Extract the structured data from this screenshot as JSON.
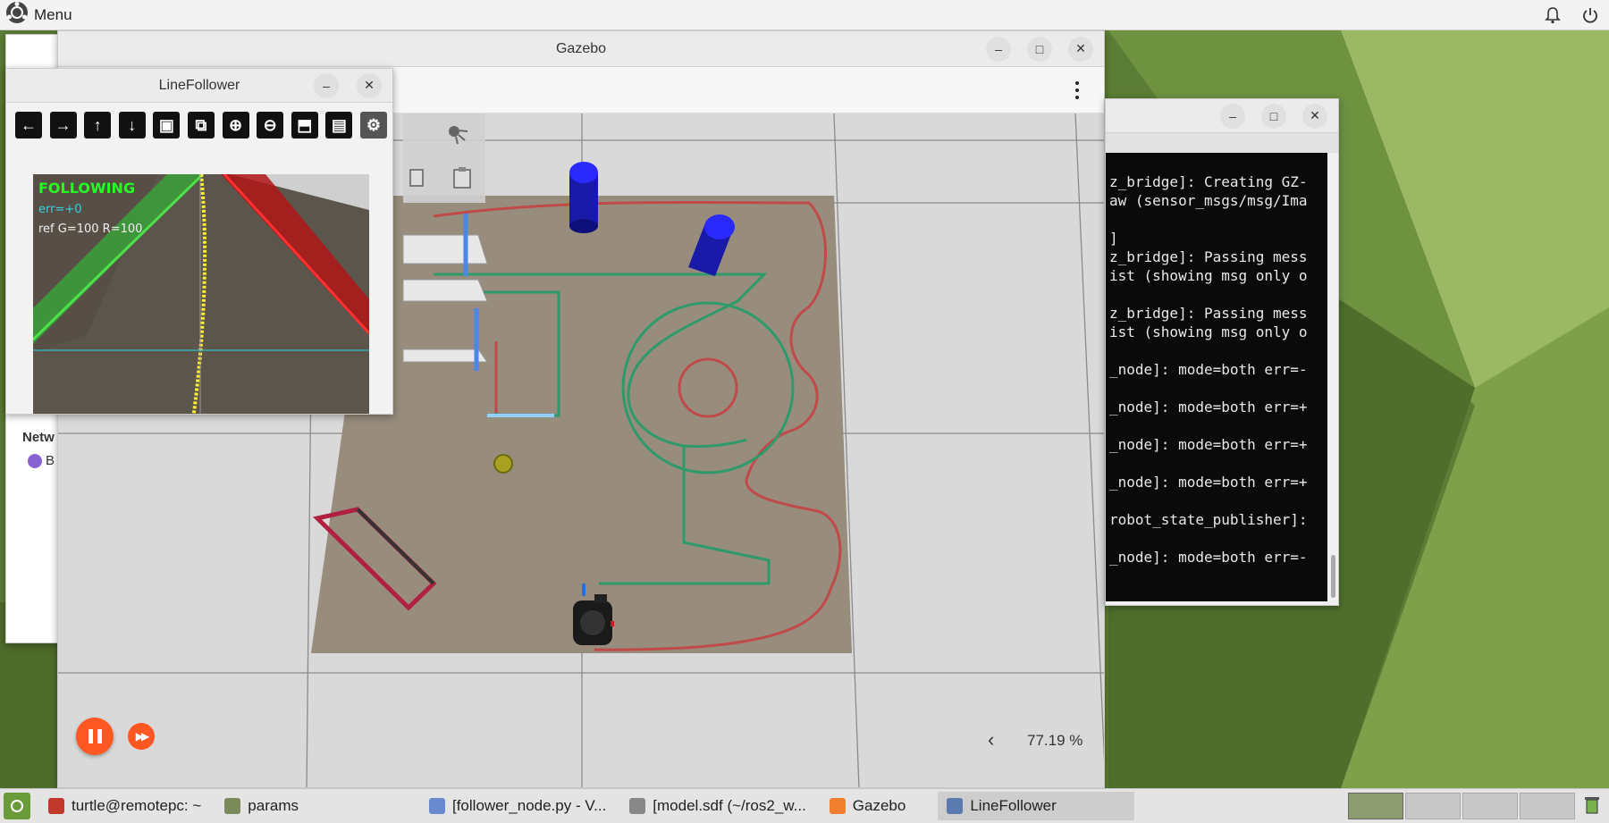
{
  "topbar": {
    "menu_label": "Menu",
    "icons": [
      "menu-logo-icon",
      "notification-icon",
      "power-icon"
    ]
  },
  "gazebo": {
    "title": "Gazebo",
    "zoom_level": "77.19 %",
    "zoom_prev": "‹",
    "controls": [
      "pause-icon",
      "step-forward-icon"
    ]
  },
  "linefollower": {
    "title": "LineFollower",
    "tools": [
      "arrow-left-icon",
      "arrow-right-icon",
      "arrow-up-icon",
      "arrow-down-icon",
      "image-icon",
      "image-zoom-icon",
      "zoom-in-icon",
      "zoom-out-icon",
      "save-icon",
      "clipboard-icon",
      "settings-icon"
    ],
    "overlay": {
      "status": "FOLLOWING",
      "error": "err=+0",
      "ref": "ref G=100 R=100"
    }
  },
  "behind_window": {
    "label_network": "Netw",
    "item": "B"
  },
  "terminal": {
    "lines": [
      "z_bridge]: Creating GZ-",
      "aw (sensor_msgs/msg/Ima",
      "",
      "]",
      "z_bridge]: Passing mess",
      "ist (showing msg only o",
      "",
      "z_bridge]: Passing mess",
      "ist (showing msg only o",
      "",
      "_node]: mode=both err=-",
      "",
      "_node]: mode=both err=+",
      "",
      "_node]: mode=both err=+",
      "",
      "_node]: mode=both err=+",
      "",
      "robot_state_publisher]:",
      "",
      "_node]: mode=both err=-"
    ]
  },
  "taskbar": {
    "items": [
      {
        "label": "turtle@remotepc: ~",
        "icon": "terminal-icon"
      },
      {
        "label": "params",
        "icon": "folder-icon"
      },
      {
        "label": "[follower_node.py - V...",
        "icon": "vscode-icon"
      },
      {
        "label": "[model.sdf (~/ros2_w...",
        "icon": "text-editor-icon"
      },
      {
        "label": "Gazebo",
        "icon": "gazebo-icon"
      },
      {
        "label": "LineFollower",
        "icon": "window-icon"
      }
    ]
  },
  "colors": {
    "accent_orange": "#ff5722",
    "terminal_bg": "#0a0a0a",
    "desktop_green": "#6b8c3d"
  }
}
